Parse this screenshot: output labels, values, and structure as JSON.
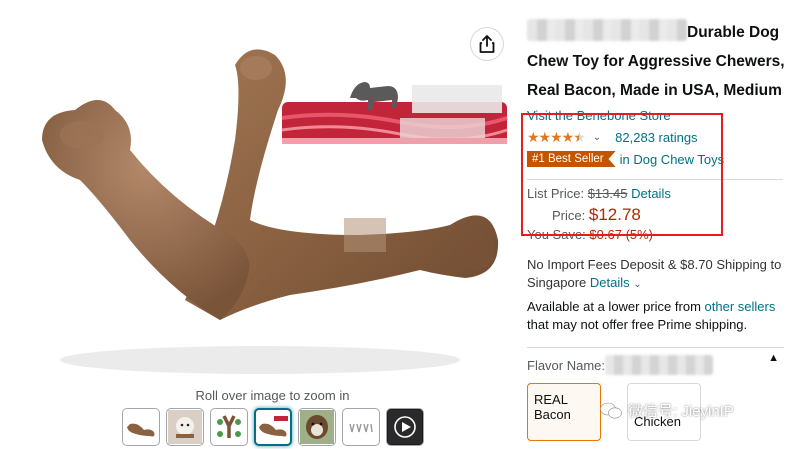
{
  "product": {
    "title_line1_visible": "Durable Dog",
    "title_rest": "Chew Toy for Aggressive Chewers, Real Bacon, Made in USA, Medium",
    "store_link": "Visit the Benebone Store",
    "rating_stars": 4.5,
    "ratings_count": "82,283 ratings",
    "best_seller_badge": "#1 Best Seller",
    "best_seller_category": "in Dog Chew Toys",
    "list_price_label": "List Price:",
    "list_price": "$13.45",
    "details_link": "Details",
    "price_label": "Price:",
    "price": "$12.78",
    "you_save_label": "You Save:",
    "you_save": "$0.67 (5%)",
    "shipping_text": "No Import Fees Deposit & $8.70 Shipping to Singapore",
    "shipping_details_link": "Details",
    "availability_text": "Available at a lower price from",
    "other_sellers_link": "other sellers",
    "availability_text2": "that may not offer free Prime shipping.",
    "flavor_label": "Flavor Name:",
    "swatches": [
      {
        "label": "REAL Bacon",
        "selected": true
      },
      {
        "label": "Chicken",
        "selected": false
      }
    ]
  },
  "gallery": {
    "zoom_hint": "Roll over image to zoom in",
    "thumbnails": [
      "wishbone-thumb",
      "dog-with-toy-thumb",
      "infographic-thumb",
      "wishbone-selected-thumb",
      "dog-chewing-thumb",
      "size-chart-thumb",
      "video-thumb"
    ],
    "selected_index": 3
  },
  "watermark": {
    "text": "微信号: JieyinIP"
  },
  "colors": {
    "link": "#007185",
    "price": "#b12704",
    "badge": "#c45500",
    "star": "#de7921",
    "highlight": "#e41d1d"
  }
}
